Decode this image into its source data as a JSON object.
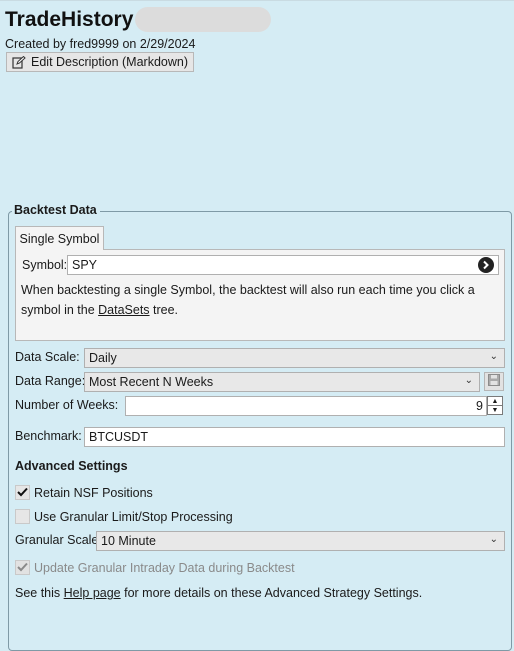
{
  "header": {
    "title": "TradeHistory",
    "created_by": "Created by fred9999 on 2/29/2024",
    "edit_button_label": "Edit Description (Markdown)"
  },
  "backtest": {
    "group_title": "Backtest Data",
    "tab_label": "Single Symbol",
    "symbol_label": "Symbol:",
    "symbol_value": "SPY",
    "info_text_1": "When backtesting a single Symbol, the backtest will also run each time you click a symbol in the ",
    "info_link": "DataSets",
    "info_text_2": " tree.",
    "data_scale_label": "Data Scale:",
    "data_scale_value": "Daily",
    "data_range_label": "Data Range:",
    "data_range_value": "Most Recent N Weeks",
    "num_weeks_label": "Number of Weeks:",
    "num_weeks_value": "9",
    "benchmark_label": "Benchmark:",
    "benchmark_value": "BTCUSDT"
  },
  "advanced": {
    "heading": "Advanced Settings",
    "retain_nsf_label": "Retain NSF Positions",
    "retain_nsf_checked": true,
    "granular_processing_label": "Use Granular Limit/Stop Processing",
    "granular_processing_checked": false,
    "granular_scale_label": "Granular Scale",
    "granular_scale_value": "10 Minute",
    "update_granular_label": "Update Granular Intraday Data during Backtest",
    "update_granular_checked": true,
    "help_prefix": "See this ",
    "help_link": "Help page",
    "help_suffix": " for more details on these Advanced Strategy Settings."
  },
  "icons": {
    "edit": "edit-icon",
    "symbol_go": "arrow-right-circle-icon",
    "save": "save-disk-icon",
    "spinner_up": "up-icon",
    "spinner_down": "down-icon",
    "chevron": "chevron-down-icon",
    "check": "checkmark-icon"
  }
}
